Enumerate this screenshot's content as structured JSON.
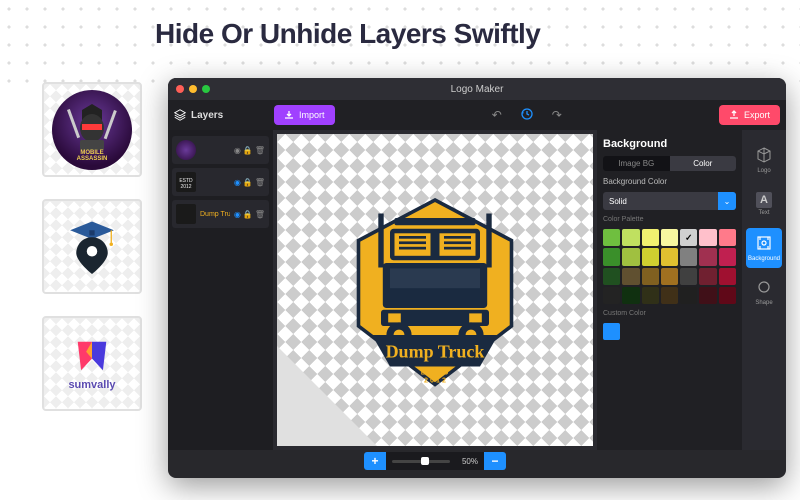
{
  "hero": {
    "title": "Hide Or Unhide Layers Swiftly"
  },
  "thumbnails": [
    {
      "name": "mobile-assassin",
      "line1": "MOBILE",
      "line2": "ASSASSIN"
    },
    {
      "name": "scholar-pin",
      "line1": "",
      "line2": ""
    },
    {
      "name": "sumvally",
      "line1": "sumvally",
      "line2": ""
    }
  ],
  "window": {
    "title": "Logo Maker"
  },
  "toolbar": {
    "layers_label": "Layers",
    "import_label": "Import",
    "export_label": "Export"
  },
  "layers": [
    {
      "label": "",
      "selected": false
    },
    {
      "label": "",
      "selected": false,
      "extra": "ESTD 2012"
    },
    {
      "label": "Dump Truck",
      "selected": true
    }
  ],
  "canvas_logo": {
    "title": "Dump Truck",
    "sub1": "ESTD",
    "sub2": "2012"
  },
  "bg_panel": {
    "title": "Background",
    "tabs": [
      "Image BG",
      "Color"
    ],
    "active_tab": 1,
    "bg_color_label": "Background Color",
    "fill_type": "Solid",
    "palette_label": "Color Palette",
    "custom_label": "Custom Color"
  },
  "palette": [
    "#6fbf3f",
    "#c0e060",
    "#f0f070",
    "#f7f7a0",
    "#d0d0d0",
    "#ffc0cb",
    "#ff7a8a",
    "#3a8f2a",
    "#a0c040",
    "#d0d030",
    "#e0c030",
    "#808080",
    "#a03050",
    "#c02050",
    "#205020",
    "#605030",
    "#806020",
    "#a07020",
    "#404040",
    "#702030",
    "#a01030",
    "#232323",
    "#103010",
    "#303018",
    "#403018",
    "#202020",
    "#401018",
    "#600818"
  ],
  "palette_selected_index": 4,
  "right_tabs": [
    {
      "label": "Logo",
      "icon": "cube"
    },
    {
      "label": "Text",
      "icon": "A"
    },
    {
      "label": "Background",
      "icon": "image",
      "active": true
    },
    {
      "label": "Shape",
      "icon": "circle"
    }
  ],
  "zoom": {
    "value": "50%"
  }
}
